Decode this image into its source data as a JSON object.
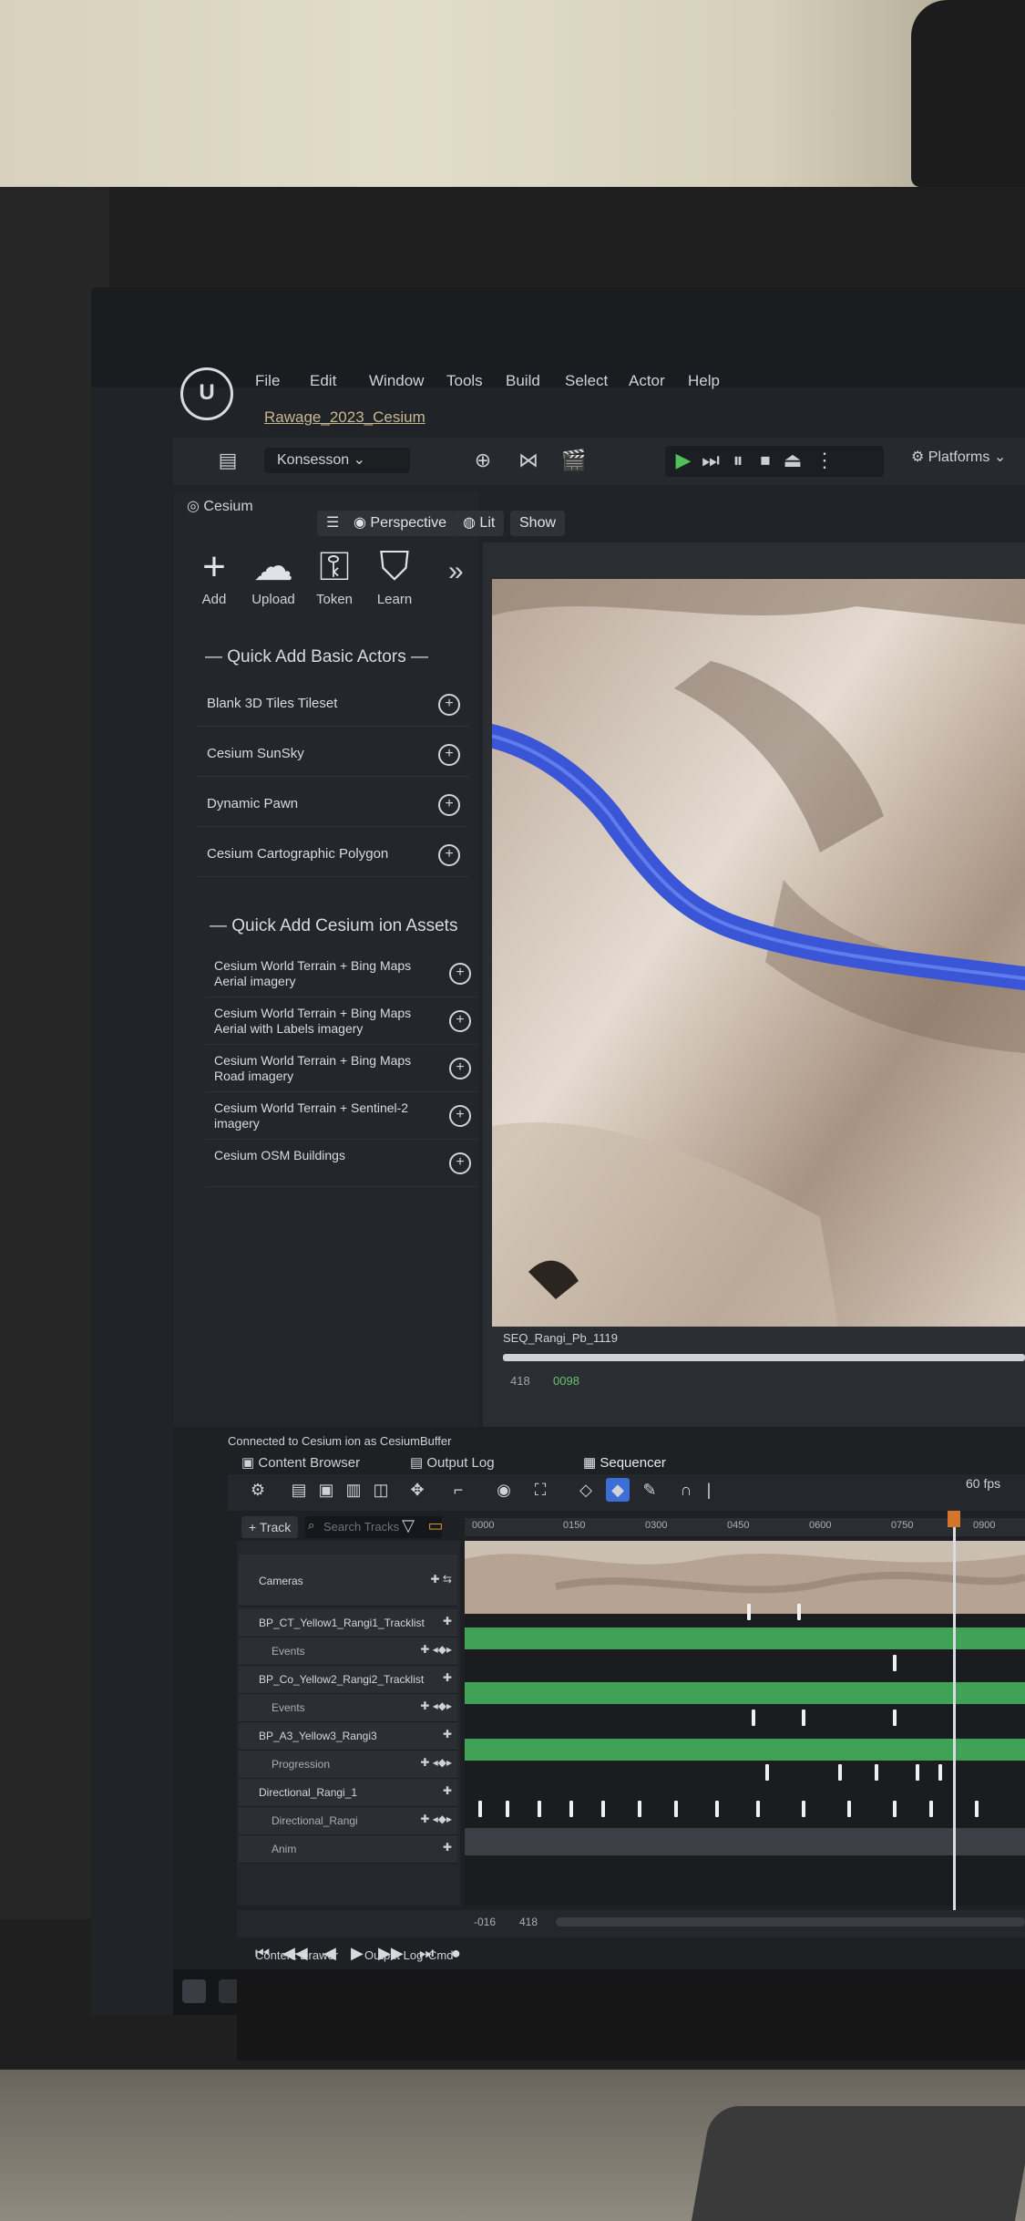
{
  "menu": {
    "items": [
      "File",
      "Edit",
      "Window",
      "Tools",
      "Build",
      "Select",
      "Actor",
      "Help"
    ],
    "level_tab": "Rawage_2023_Cesium"
  },
  "toolbar": {
    "mode": "Konsesson",
    "platforms": "Platforms"
  },
  "cesium_panel": {
    "tab": "Cesium",
    "tools": [
      {
        "label": "Add",
        "icon": "plus-icon"
      },
      {
        "label": "Upload",
        "icon": "cloud-upload-icon"
      },
      {
        "label": "Token",
        "icon": "key-icon"
      },
      {
        "label": "Learn",
        "icon": "learn-icon"
      }
    ],
    "quick_add_basic_title": "Quick Add Basic Actors",
    "basic_actors": [
      "Blank 3D Tiles Tileset",
      "Cesium SunSky",
      "Dynamic Pawn",
      "Cesium Cartographic Polygon"
    ],
    "quick_add_ion_title": "Quick Add Cesium ion Assets",
    "ion_assets": [
      "Cesium World Terrain + Bing Maps Aerial imagery",
      "Cesium World Terrain + Bing Maps Aerial with Labels imagery",
      "Cesium World Terrain + Bing Maps Road imagery",
      "Cesium World Terrain + Sentinel-2 imagery",
      "Cesium OSM Buildings"
    ]
  },
  "viewport": {
    "perspective": "Perspective",
    "lit": "Lit",
    "show": "Show",
    "caption": "SEQ_Rangi_Pb_1119",
    "frame_start": "418",
    "frame_current": "0098"
  },
  "bottom": {
    "status": "Connected to Cesium ion as CesiumBuffer",
    "tabs": [
      "Content Browser",
      "Output Log",
      "Sequencer"
    ],
    "fps": "60 fps",
    "add_track": "+ Track",
    "search_placeholder": "Search Tracks",
    "ruler_ticks": [
      "0000",
      "0150",
      "0300",
      "0450",
      "0600",
      "0750",
      "0900"
    ],
    "tracks": [
      {
        "name": "Cameras",
        "sub": false
      },
      {
        "name": "BP_CT_Yellow1_Rangi1_Tracklist",
        "sub": false
      },
      {
        "name": "Events",
        "sub": true
      },
      {
        "name": "BP_Co_Yellow2_Rangi2_Tracklist",
        "sub": false
      },
      {
        "name": "Events",
        "sub": true
      },
      {
        "name": "BP_A3_Yellow3_Rangi3",
        "sub": false
      },
      {
        "name": "Progression",
        "sub": true
      },
      {
        "name": "Directional_Rangi_1",
        "sub": false
      },
      {
        "name": "Directional_Rangi",
        "sub": true
      },
      {
        "name": "Anim",
        "sub": true
      }
    ],
    "time_a": "-016",
    "time_b": "418",
    "content_drawer": "Content Drawer",
    "output_log": "Output Log",
    "cmd": "Cmd"
  }
}
